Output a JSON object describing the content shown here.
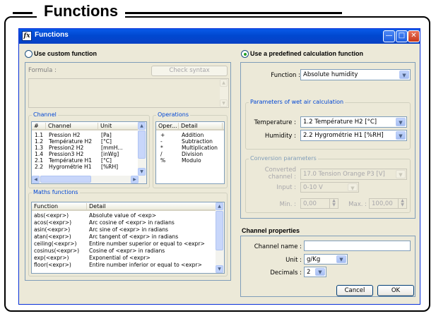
{
  "document": {
    "heading": "Functions"
  },
  "window": {
    "title": "Functions",
    "icon": "fx-icon"
  },
  "left": {
    "custom_radio_label": "Use custom function",
    "formula_label": "Formula :",
    "check_syntax": "Check syntax",
    "channel": {
      "group_label": "Channel",
      "columns": [
        "#",
        "Channel",
        "Unit"
      ],
      "rows": [
        [
          "1.1",
          "Pression H2",
          "[Pa]"
        ],
        [
          "1.2",
          "Température H2",
          "[°C]"
        ],
        [
          "1.3",
          "Pression2 H2",
          "[mmH..."
        ],
        [
          "1.4",
          "Pression3 H2",
          "[inWg]"
        ],
        [
          "2.1",
          "Température H1",
          "[°C]"
        ],
        [
          "2.2",
          "Hygrométrie H1",
          "[%RH]"
        ]
      ]
    },
    "operations": {
      "group_label": "Operations",
      "columns": [
        "Oper...",
        "Detail"
      ],
      "rows": [
        [
          "+",
          "Addition"
        ],
        [
          "-",
          "Subtraction"
        ],
        [
          "*",
          "Multiplication"
        ],
        [
          "/",
          "Division"
        ],
        [
          "%",
          "Modulo"
        ]
      ]
    },
    "maths": {
      "group_label": "Maths functions",
      "columns": [
        "Function",
        "Detail"
      ],
      "rows": [
        [
          "abs(<expr>)",
          "Absolute value of <exp>"
        ],
        [
          "acos(<expr>)",
          "Arc cosine of <expr> in radians"
        ],
        [
          "asin(<expr>)",
          "Arc sine of <expr> in radians"
        ],
        [
          "atan(<expr>)",
          "Arc tangent of <expr> in radians"
        ],
        [
          "ceiling(<expr>)",
          "Entire number superior or equal to <expr>"
        ],
        [
          "cosinus(<expr>)",
          "Cosine of <expr> in radians"
        ],
        [
          "exp(<expr>)",
          "Exponential of <expr>"
        ],
        [
          "floor(<expr>)",
          "Entire number inferior or equal to <expr>"
        ]
      ]
    }
  },
  "right": {
    "predefined_radio_label": "Use a predefined calculation function",
    "function_label": "Function :",
    "function_value": "Absolute humidity",
    "wet_air": {
      "group_label": "Parameters of wet air calculation",
      "temperature_label": "Temperature :",
      "temperature_value": "1.2 Température H2 [°C]",
      "humidity_label": "Humidity :",
      "humidity_value": "2.2 Hygrométrie H1 [%RH]"
    },
    "conversion": {
      "group_label": "Conversion parameters",
      "converted_label_1": "Converted",
      "converted_label_2": "channel :",
      "converted_value": "17.0 Tension Orange P3 [V]",
      "input_label": "Input :",
      "input_value": "0-10 V",
      "min_label": "Min. :",
      "min_value": "0,00",
      "max_label": "Max. :",
      "max_value": "100,00"
    },
    "properties": {
      "title": "Channel properties",
      "name_label": "Channel name :",
      "name_value": "",
      "unit_label": "Unit :",
      "unit_value": "g/Kg",
      "decimals_label": "Decimals :",
      "decimals_value": "2"
    },
    "cancel": "Cancel",
    "ok": "OK"
  }
}
